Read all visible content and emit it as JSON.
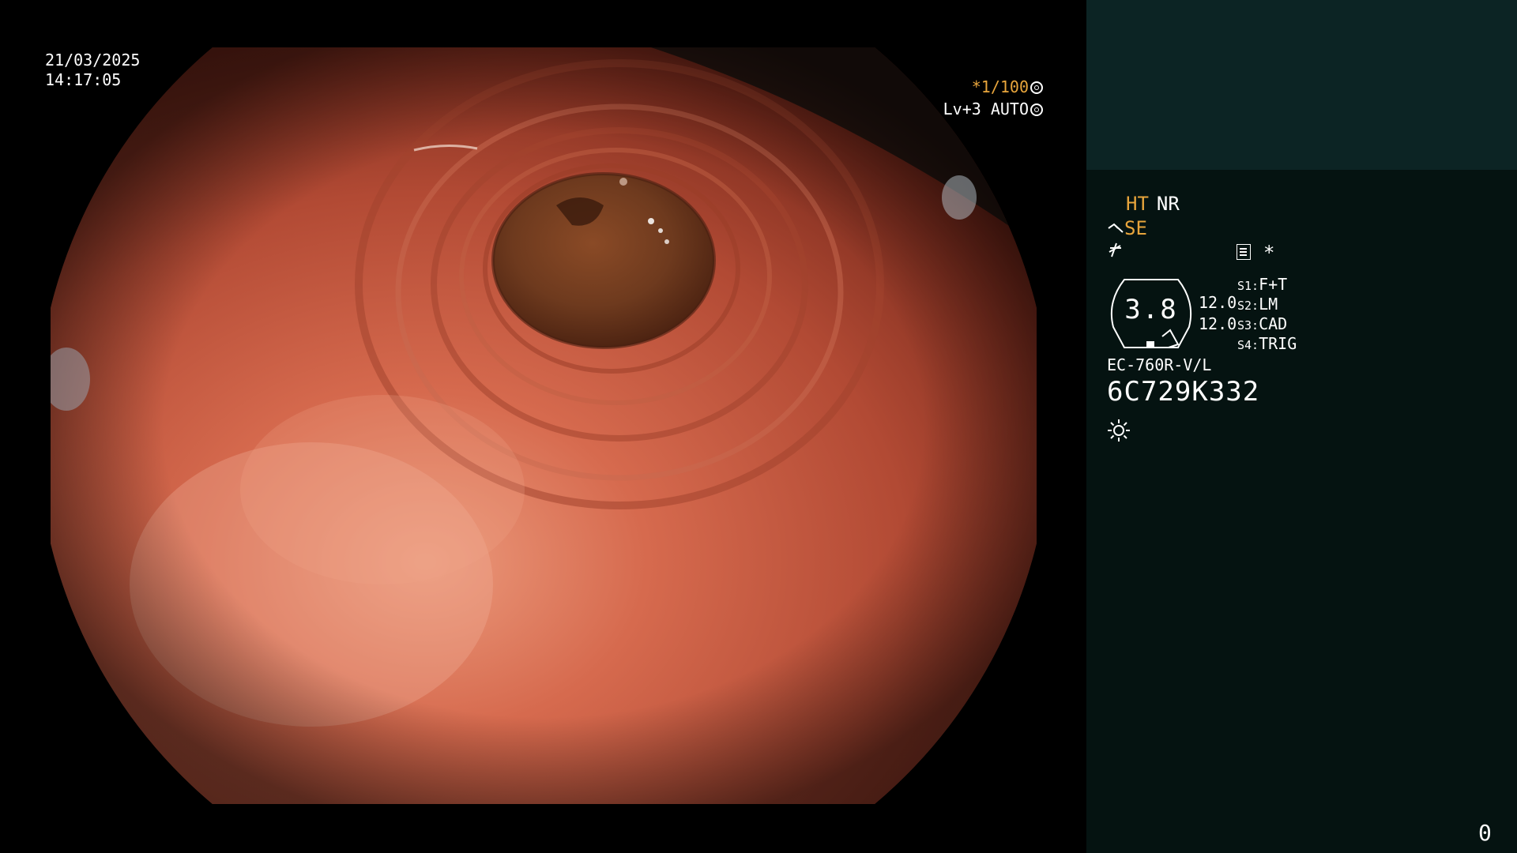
{
  "osd": {
    "date": "21/03/2025",
    "time": "14:17:05",
    "shutter": "*1/100",
    "light_level": "Lv+3 AUTO"
  },
  "side_panel": {
    "ht": "HT",
    "nr": "NR",
    "se": "SE",
    "star": "*",
    "zoom": "3.8",
    "range_top": "12.0",
    "range_bottom": "12.0",
    "switches": [
      {
        "key": "S1:",
        "value": "F+T"
      },
      {
        "key": "S2:",
        "value": "LM"
      },
      {
        "key": "S3:",
        "value": "CAD"
      },
      {
        "key": "S4:",
        "value": "TRIG"
      }
    ],
    "scope_model": "EC-760R-V/L",
    "serial": "6C729K332",
    "counter": "0"
  },
  "colors": {
    "panel_bg": "#051311",
    "thumb_bg": "#0c2424",
    "accent_amber": "#e8a53c",
    "mucosa": "#c8503a",
    "lumen": "#6e3a1e"
  },
  "icons": {
    "shutter": "shutter-icon",
    "light": "iris-icon",
    "scope": "scope-mode-icon",
    "enhance": "enhance-icon",
    "menu": "menu-icon",
    "illumination": "sun-icon"
  }
}
